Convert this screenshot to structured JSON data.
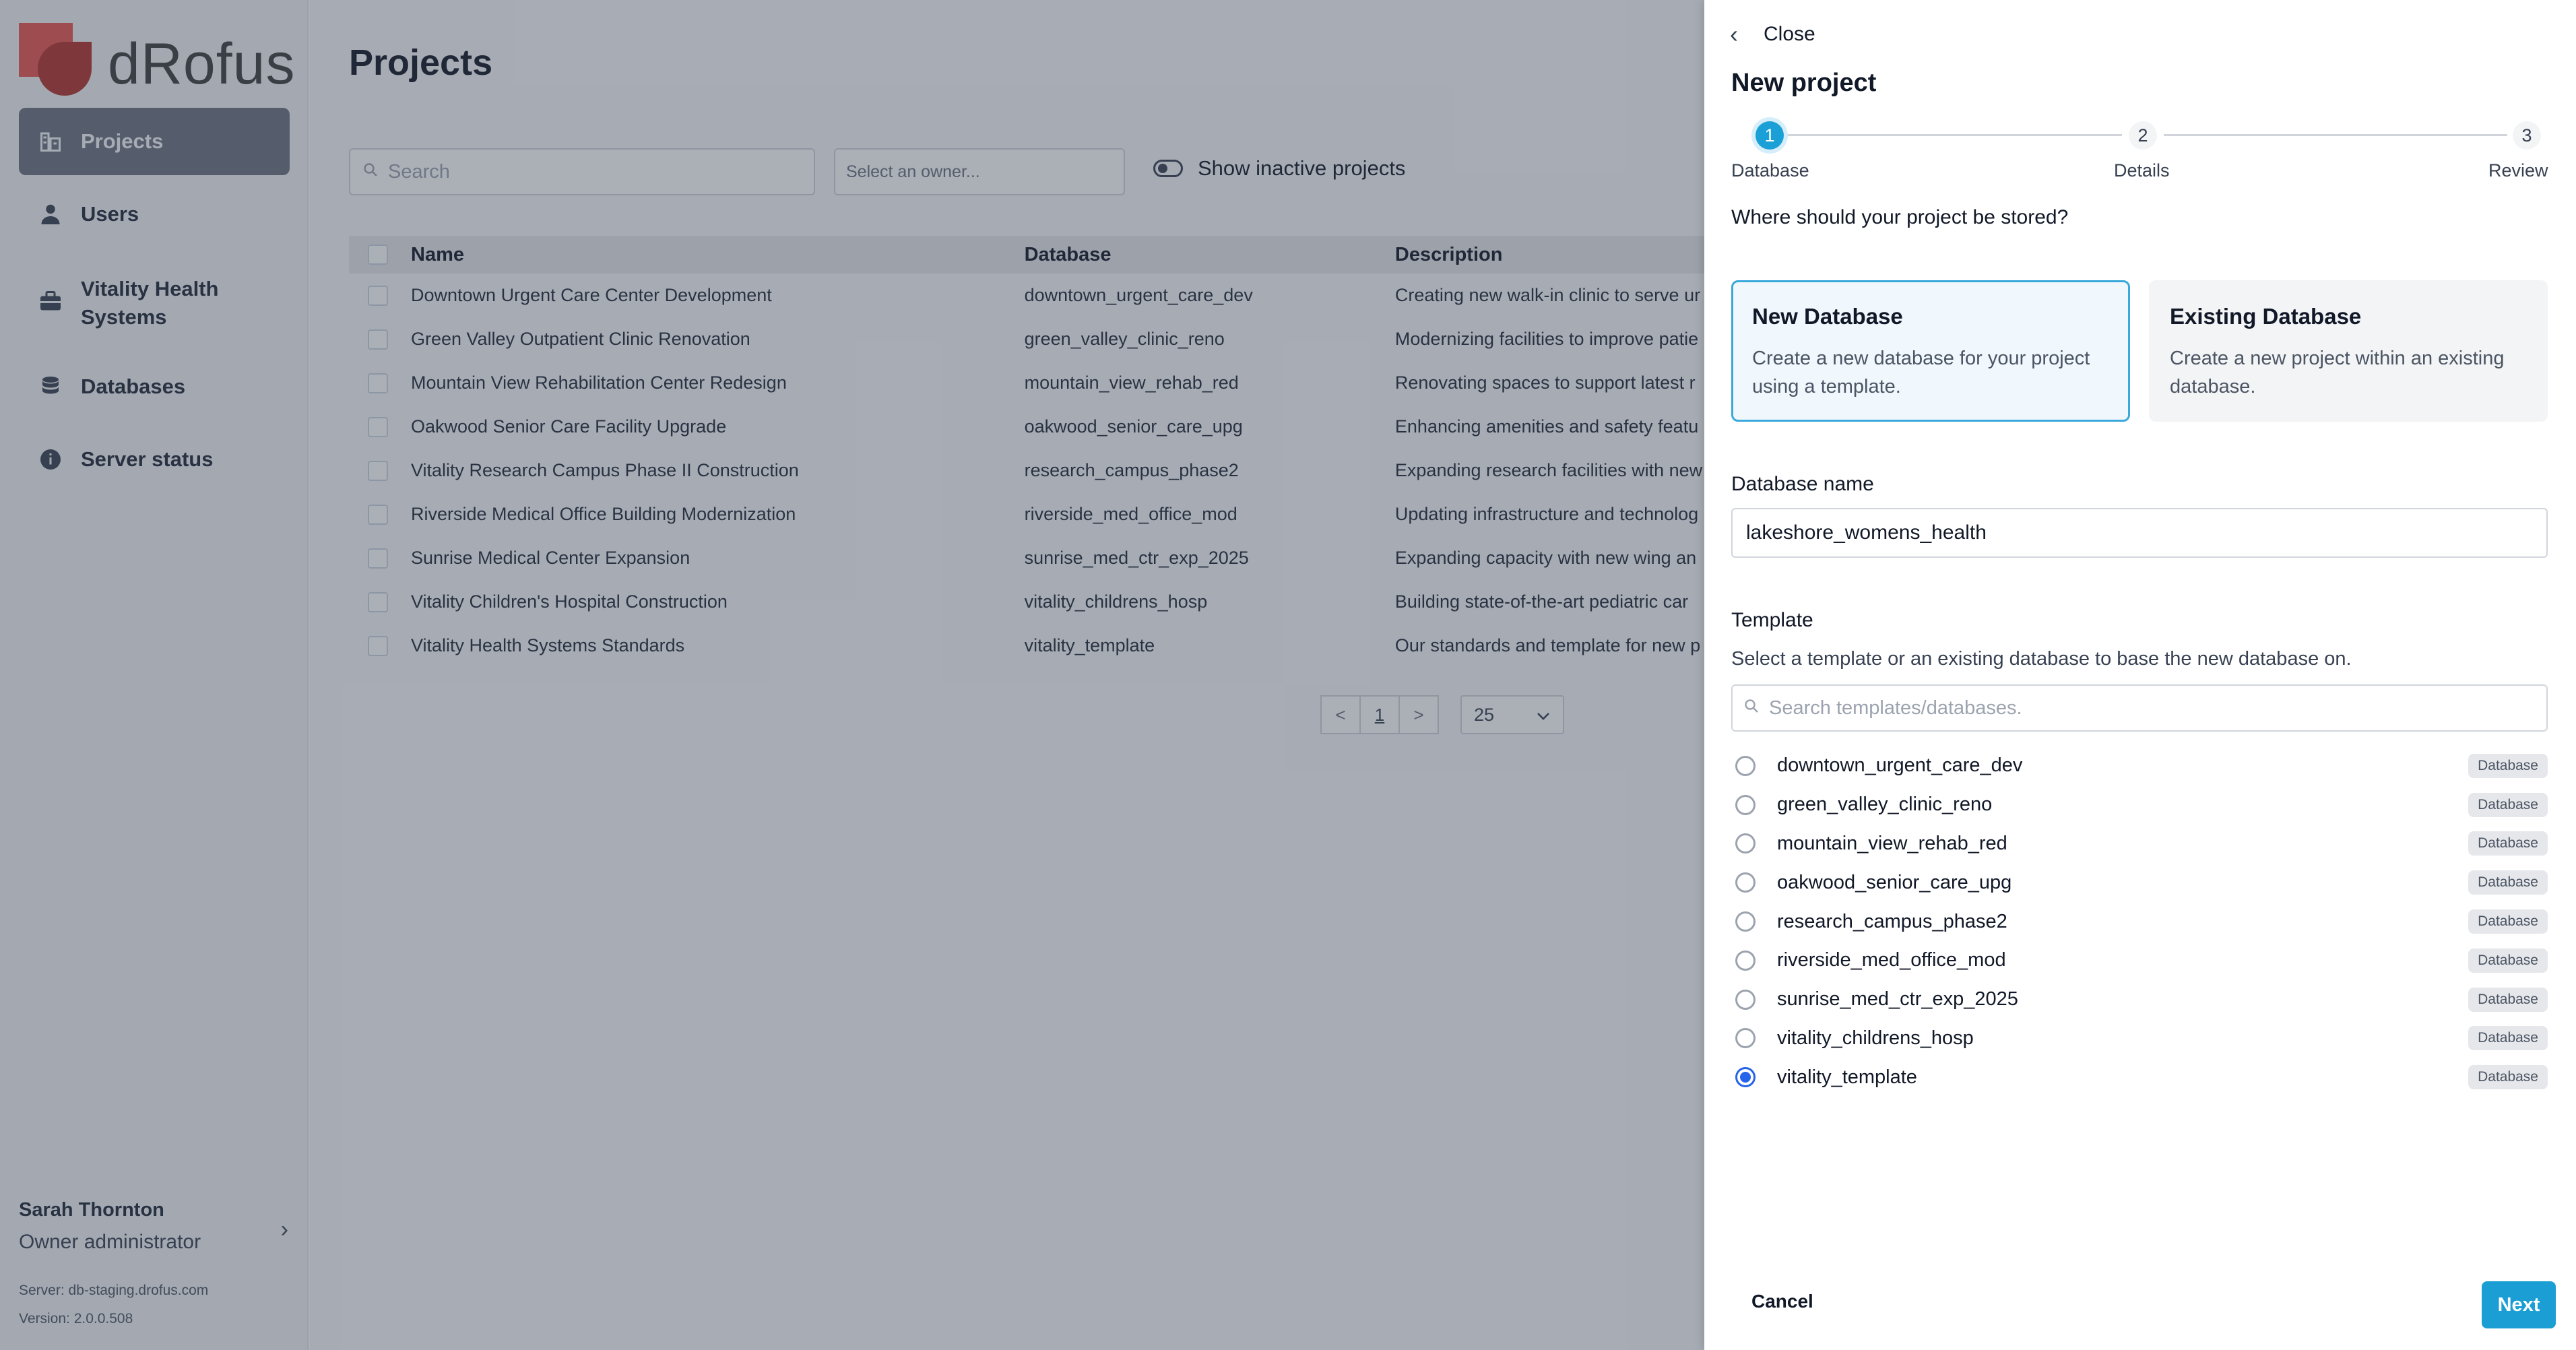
{
  "app": {
    "logo_text": "dRofus"
  },
  "sidebar": {
    "items": [
      {
        "label": "Projects",
        "icon": "building-icon"
      },
      {
        "label": "Users",
        "icon": "user-icon"
      },
      {
        "label": "Vitality Health Systems",
        "icon": "briefcase-icon"
      },
      {
        "label": "Databases",
        "icon": "database-icon"
      },
      {
        "label": "Server status",
        "icon": "info-icon"
      }
    ],
    "user_name": "Sarah Thornton",
    "user_role": "Owner administrator",
    "server": "Server: db-staging.drofus.com",
    "version": "Version: 2.0.0.508"
  },
  "main": {
    "title": "Projects",
    "search_placeholder": "Search",
    "owner_placeholder": "Select an owner...",
    "toggle_label": "Show inactive projects",
    "columns": {
      "name": "Name",
      "database": "Database",
      "description": "Description"
    },
    "rows": [
      {
        "name": "Downtown Urgent Care Center Development",
        "database": "downtown_urgent_care_dev",
        "description": "Creating new walk-in clinic to serve ur"
      },
      {
        "name": "Green Valley Outpatient Clinic Renovation",
        "database": "green_valley_clinic_reno",
        "description": "Modernizing facilities to improve patie"
      },
      {
        "name": "Mountain View Rehabilitation Center Redesign",
        "database": "mountain_view_rehab_red",
        "description": "Renovating spaces to support latest r"
      },
      {
        "name": "Oakwood Senior Care Facility Upgrade",
        "database": "oakwood_senior_care_upg",
        "description": "Enhancing amenities and safety featu"
      },
      {
        "name": "Vitality Research Campus Phase II Construction",
        "database": "research_campus_phase2",
        "description": "Expanding research facilities with new"
      },
      {
        "name": "Riverside Medical Office Building Modernization",
        "database": "riverside_med_office_mod",
        "description": "Updating infrastructure and technolog"
      },
      {
        "name": "Sunrise Medical Center Expansion",
        "database": "sunrise_med_ctr_exp_2025",
        "description": "Expanding capacity with new wing an"
      },
      {
        "name": "Vitality Children's Hospital Construction",
        "database": "vitality_childrens_hosp",
        "description": "Building state-of-the-art pediatric car"
      },
      {
        "name": "Vitality Health Systems Standards",
        "database": "vitality_template",
        "description": "Our standards and template for new p"
      }
    ],
    "pager": {
      "prev": "<",
      "page": "1",
      "next": ">",
      "per_page": "25"
    }
  },
  "drawer": {
    "close_label": "Close",
    "title": "New project",
    "steps": [
      {
        "num": "1",
        "label": "Database"
      },
      {
        "num": "2",
        "label": "Details"
      },
      {
        "num": "3",
        "label": "Review"
      }
    ],
    "question": "Where should your project be stored?",
    "options": [
      {
        "title": "New Database",
        "desc": "Create a new database for your project using a template."
      },
      {
        "title": "Existing Database",
        "desc": "Create a new project within an existing database."
      }
    ],
    "db_name_label": "Database name",
    "db_name_value": "lakeshore_womens_health",
    "template_label": "Template",
    "template_help": "Select a template or an existing database to base the new database on.",
    "template_search_placeholder": "Search templates/databases.",
    "templates": [
      {
        "name": "downtown_urgent_care_dev",
        "badge": "Database"
      },
      {
        "name": "green_valley_clinic_reno",
        "badge": "Database"
      },
      {
        "name": "mountain_view_rehab_red",
        "badge": "Database"
      },
      {
        "name": "oakwood_senior_care_upg",
        "badge": "Database"
      },
      {
        "name": "research_campus_phase2",
        "badge": "Database"
      },
      {
        "name": "riverside_med_office_mod",
        "badge": "Database"
      },
      {
        "name": "sunrise_med_ctr_exp_2025",
        "badge": "Database"
      },
      {
        "name": "vitality_childrens_hosp",
        "badge": "Database"
      },
      {
        "name": "vitality_template",
        "badge": "Database"
      }
    ],
    "selected_template": "vitality_template",
    "cancel_label": "Cancel",
    "next_label": "Next"
  },
  "colors": {
    "accent": "#1a9ed4",
    "radio_selected": "#2563eb",
    "logo_red": "#e8554e"
  }
}
